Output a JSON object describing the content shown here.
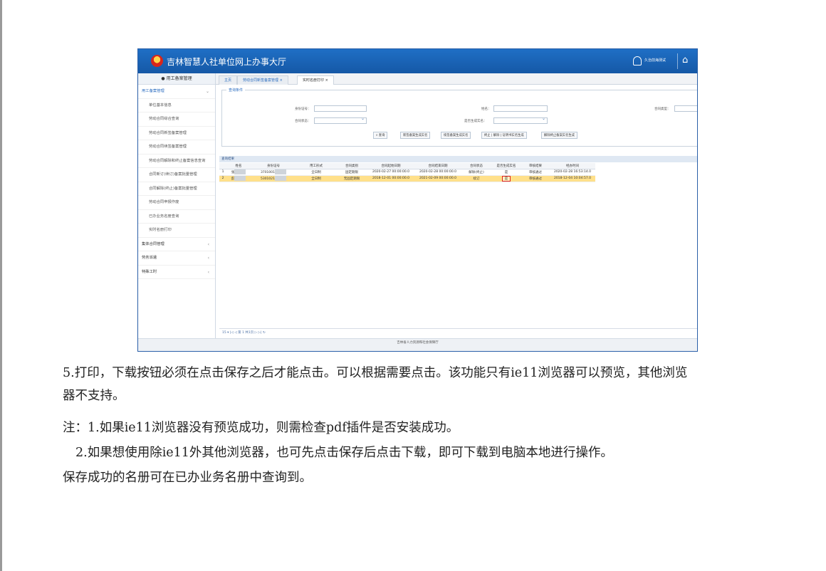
{
  "screenshot": {
    "app_title": "吉林智慧人社单位网上办事大厅",
    "user_name": "久治前海测试",
    "sidebar": {
      "header": "用工备案管理",
      "items": [
        {
          "label": "用工备案管理",
          "group": true,
          "open": true,
          "chevron": "⌄"
        },
        {
          "label": "单位基本信息"
        },
        {
          "label": "劳动合同综合查询"
        },
        {
          "label": "劳动合同新签备案管理"
        },
        {
          "label": "劳动合同续签备案管理"
        },
        {
          "label": "劳动合同解除和终止备案信息查询"
        },
        {
          "label": "合同新订(续订)备案批量管理"
        },
        {
          "label": "合同解除(终止)备案批量管理"
        },
        {
          "label": "劳动合同申报作废"
        },
        {
          "label": "已办业务名册查询"
        },
        {
          "label": "实时名册打印"
        },
        {
          "label": "集体合同管理",
          "group": true,
          "chevron": "‹"
        },
        {
          "label": "劳务派遣",
          "group": true,
          "chevron": "‹"
        },
        {
          "label": "特殊工时",
          "group": true,
          "chevron": "‹"
        }
      ]
    },
    "tabs": [
      "主页",
      "劳动合同新签备案管理 ×",
      "实时名册打印 ×"
    ],
    "query": {
      "legend": "查询条件",
      "fields": [
        {
          "label": "身份证号："
        },
        {
          "label": "姓名："
        },
        {
          "label": "合同类型："
        },
        {
          "label": "合同状态："
        },
        {
          "label": "是否生成实名："
        }
      ],
      "buttons": [
        "查询",
        "新签备案生成实名",
        "续签备案生成实名",
        "终止 | 解除 | 证明书实名生成",
        "解除终止备案实名生成"
      ]
    },
    "results": {
      "title": "查询结果",
      "columns": [
        "",
        "姓名",
        "身份证号",
        "用工形式",
        "合同类别",
        "合同起始日期",
        "合同结束日期",
        "合同状态",
        "是否生成实名",
        "审核结果",
        "经办时间"
      ],
      "rows": [
        [
          "1",
          "张",
          "3701001",
          "全日制",
          "固定期限",
          "2020-02-27 00:00:00.0",
          "2020-02-28 00:00:00.0",
          "解除(终止)",
          "是",
          "审核通过",
          "2020-02-28 16:53:14.0"
        ],
        [
          "2",
          "彭",
          "5301021",
          "全日制",
          "无固定期限",
          "2018-12-01 00:00:00.0",
          "2021-02-09 00:00:00.0",
          "续订",
          "是",
          "审核通过",
          "2018-12-04 10:04:57.0"
        ]
      ]
    },
    "pager": "15 ▾   |◁  ◁  第 1   共1页  ▷  ▷|   ↻",
    "footer": "吉林省人力资源和社会保障厅"
  },
  "text": {
    "line1": "5.打印，下载按钮必须在点击保存之后才能点击。可以根据需要点击。该功能只有ie11浏览器可以预览，其他浏览",
    "line2": "器不支持。",
    "line3": "注：1.如果ie11浏览器没有预览成功，则需检查pdf插件是否安装成功。",
    "line4": "2.如果想使用除ie11外其他浏览器，也可先点击保存后点击下载，即可下载到电脑本地进行操作。",
    "line5": "保存成功的名册可在已办业务名册中查询到。"
  }
}
